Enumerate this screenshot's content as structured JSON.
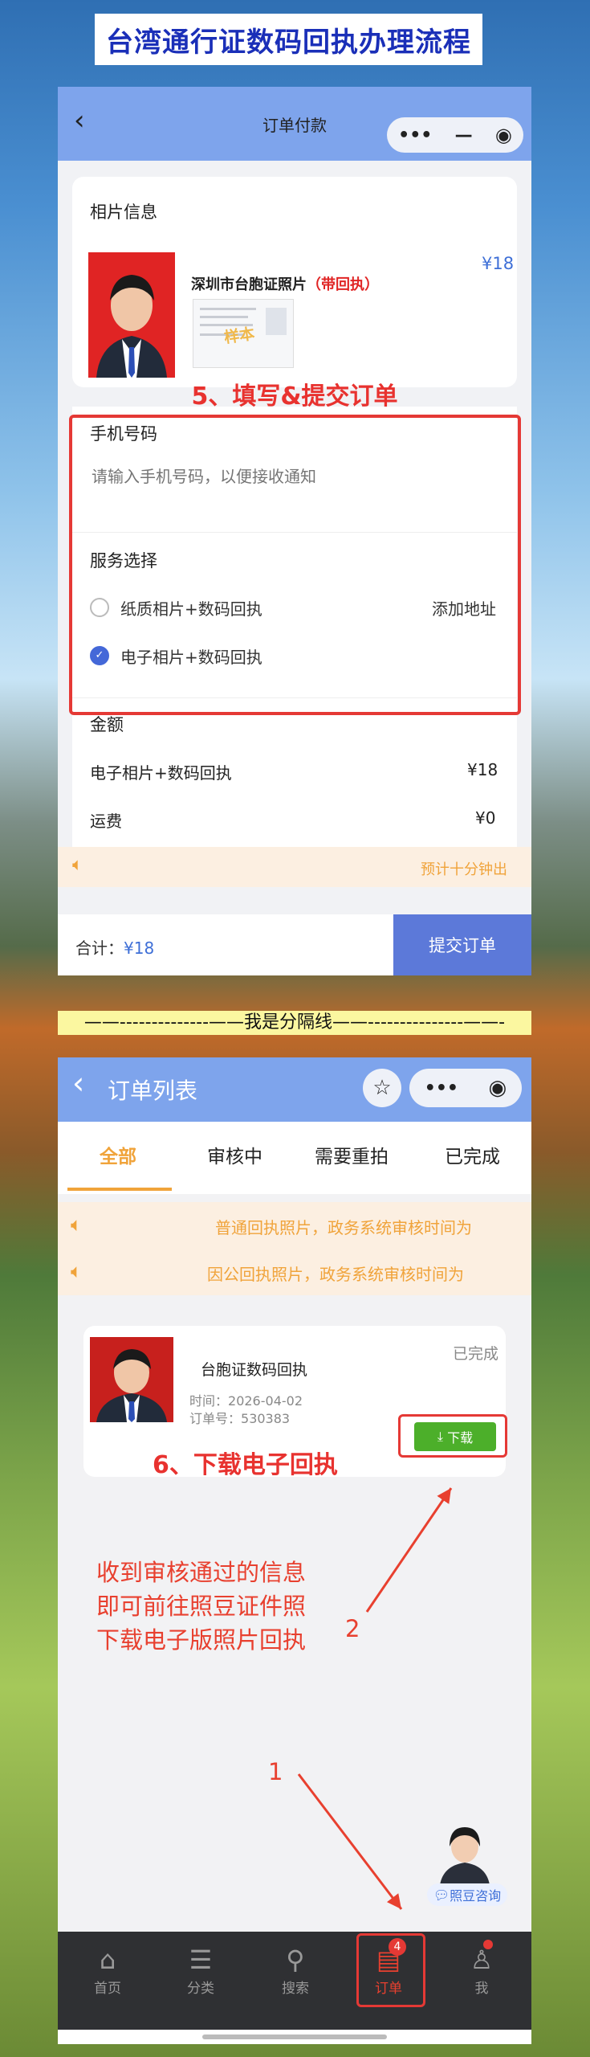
{
  "banner_title": "台湾通行证数码回执办理流程",
  "screen1": {
    "nav_title": "订单付款",
    "photo_section_title": "相片信息",
    "product_name": "深圳市台胞证照片",
    "product_tag": "（带回执）",
    "product_price": "¥18",
    "sample_stamp": "样本",
    "step5_annotation": "5、填写&提交订单",
    "phone_label": "手机号码",
    "phone_placeholder": "请输入手机号码，以便接收通知",
    "service_label": "服务选择",
    "option1_label": "纸质相片+数码回执",
    "option1_action": "添加地址",
    "option2_label": "电子相片+数码回执",
    "amount_label": "金额",
    "amount_item_label": "电子相片+数码回执",
    "amount_item_value": "¥18",
    "shipping_label": "运费",
    "shipping_value": "¥0",
    "notice_text": "预计十分钟出",
    "total_label": "合计：",
    "total_value": "¥18",
    "submit_label": "提交订单"
  },
  "divider_text": "——--------------——我是分隔线——---------------——-",
  "screen2": {
    "nav_title": "订单列表",
    "tabs": [
      "全部",
      "审核中",
      "需要重拍",
      "已完成"
    ],
    "notice1": "普通回执照片，政务系统审核时间为",
    "notice2": "因公回执照片，政务系统审核时间为",
    "order_title": "台胞证数码回执",
    "order_status": "已完成",
    "order_time_label": "时间：",
    "order_time": "2026-04-02",
    "order_no_label": "订单号：",
    "order_no": "530383",
    "download_label": "下载",
    "step6_annotation": "6、下载电子回执",
    "annotation_lines": [
      "收到审核通过的信息",
      "即可前往照豆证件照",
      "下载电子版照片回执"
    ],
    "arrow_label_2": "2",
    "arrow_label_1": "1",
    "consult_label": "照豆咨询",
    "nav_badge": "4",
    "bottom_nav": [
      "首页",
      "分类",
      "搜索",
      "订单",
      "我"
    ]
  }
}
